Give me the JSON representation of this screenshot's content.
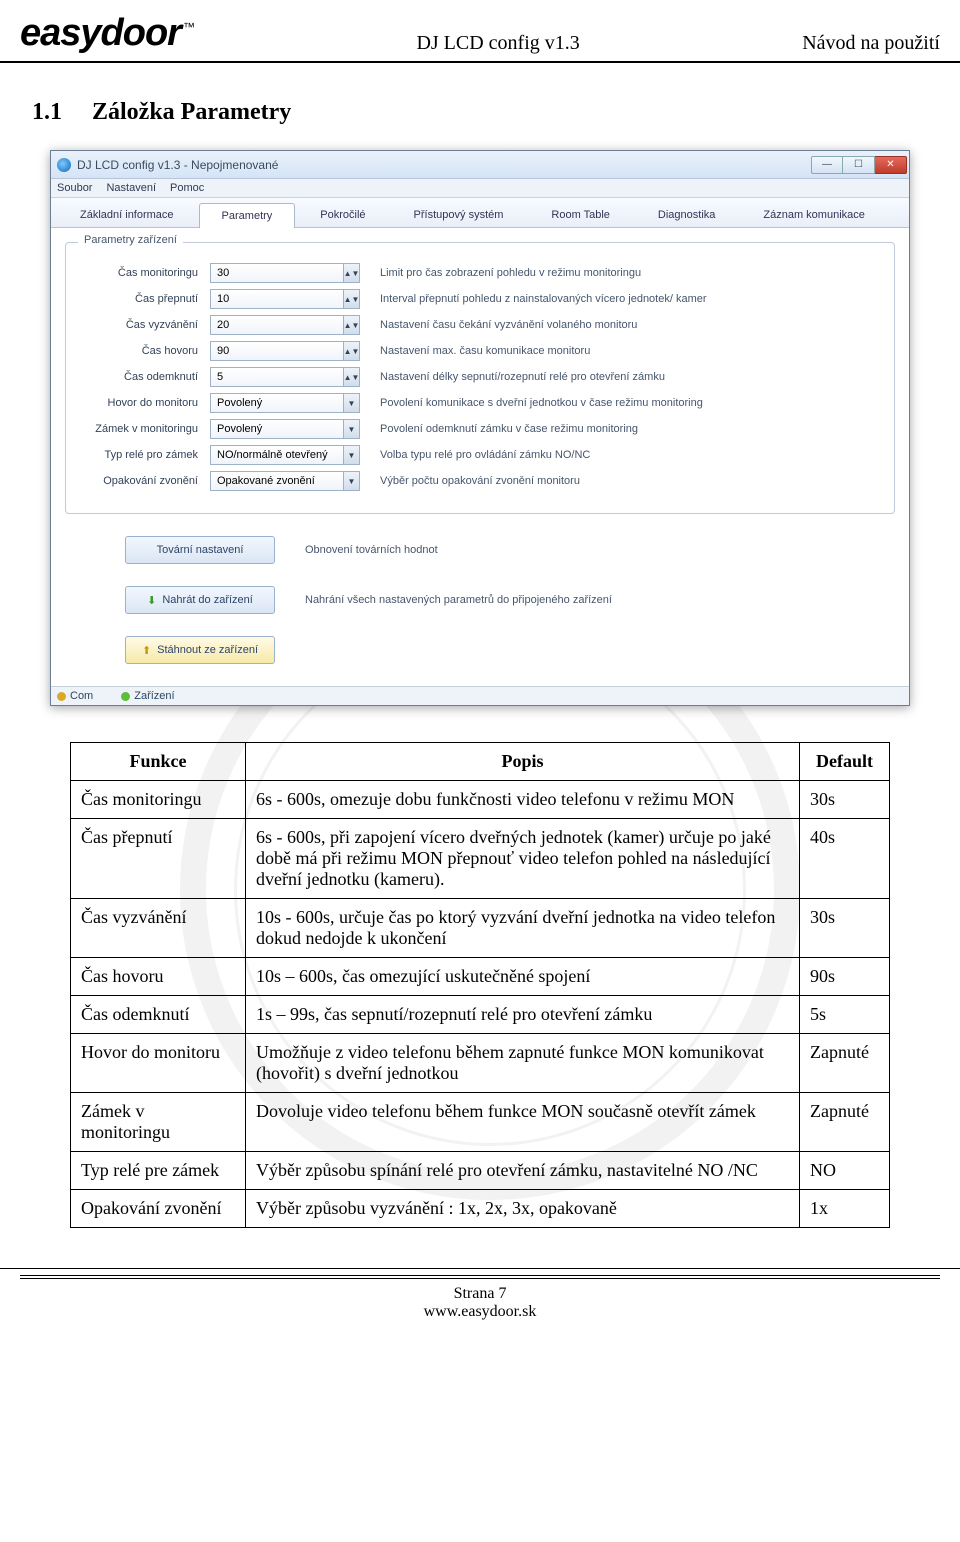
{
  "header": {
    "logo": "easydoor",
    "logo_tm": "™",
    "center": "DJ LCD config v1.3",
    "right": "Návod na použití"
  },
  "section": {
    "num": "1.1",
    "title": "Záložka Parametry"
  },
  "app": {
    "title": "DJ LCD config v1.3 - Nepojmenované",
    "menu": {
      "file": "Soubor",
      "settings": "Nastavení",
      "help": "Pomoc"
    },
    "tabs": {
      "basic": "Základní informace",
      "params": "Parametry",
      "advanced": "Pokročilé",
      "access": "Přístupový systém",
      "room": "Room Table",
      "diag": "Diagnostika",
      "comm": "Záznam komunikace"
    },
    "fieldset_legend": "Parametry zařízení",
    "rows": [
      {
        "label": "Čas monitoringu",
        "value": "30",
        "type": "spin",
        "desc": "Limit pro čas zobrazení pohledu v režimu monitoringu"
      },
      {
        "label": "Čas přepnutí",
        "value": "10",
        "type": "spin",
        "desc": "Interval přepnutí pohledu z nainstalovaných vícero jednotek/ kamer"
      },
      {
        "label": "Čas vyzvánění",
        "value": "20",
        "type": "spin",
        "desc": "Nastavení času čekání vyzvánění volaného monitoru"
      },
      {
        "label": "Čas hovoru",
        "value": "90",
        "type": "spin",
        "desc": "Nastavení max. času komunikace monitoru"
      },
      {
        "label": "Čas odemknutí",
        "value": "5",
        "type": "spin",
        "desc": "Nastavení délky sepnutí/rozepnutí relé pro otevření zámku"
      },
      {
        "label": "Hovor do monitoru",
        "value": "Povolený",
        "type": "dd",
        "desc": "Povolení komunikace s dveřní jednotkou v čase režimu monitoring"
      },
      {
        "label": "Zámek v monitoringu",
        "value": "Povolený",
        "type": "dd",
        "desc": "Povolení odemknutí zámku v čase režimu monitoring"
      },
      {
        "label": "Typ relé pro zámek",
        "value": "NO/normálně otevřený",
        "type": "dd",
        "desc": "Volba typu relé pro ovládání zámku NO/NC"
      },
      {
        "label": "Opakování zvonění",
        "value": "Opakované zvonění",
        "type": "dd",
        "desc": "Výběr počtu opakování zvonění monitoru"
      }
    ],
    "actions": {
      "factory": "Tovární nastavení",
      "factory_desc": "Obnovení továrních hodnot",
      "upload": "Nahrát do zařízení",
      "upload_desc": "Nahrání všech nastavených parametrů do připojeného zařízení",
      "download": "Stáhnout ze zařízení"
    },
    "status": {
      "com": "Com",
      "device": "Zařízení"
    },
    "win": {
      "min": "—",
      "max": "☐",
      "close": "✕"
    }
  },
  "table": {
    "headers": {
      "func": "Funkce",
      "desc": "Popis",
      "def": "Default"
    },
    "rows": [
      {
        "func": "Čas monitoringu",
        "desc": "6s - 600s, omezuje dobu funkčnosti video telefonu v režimu MON",
        "def": "30s"
      },
      {
        "func": "Čas přepnutí",
        "desc": "6s - 600s, při zapojení vícero dveřných jednotek (kamer) určuje po jaké době má při režimu MON přepnouť video telefon pohled na následující dveřní jednotku (kameru).",
        "def": "40s"
      },
      {
        "func": "Čas vyzvánění",
        "desc": "10s - 600s, určuje čas po ktorý vyzvání dveřní jednotka na video telefon dokud nedojde k ukončení",
        "def": "30s"
      },
      {
        "func": "Čas hovoru",
        "desc": "10s – 600s, čas omezující uskutečněné spojení",
        "def": "90s"
      },
      {
        "func": "Čas odemknutí",
        "desc": "1s – 99s, čas sepnutí/rozepnutí relé pro otevření zámku",
        "def": "5s"
      },
      {
        "func": "Hovor do monitoru",
        "desc": "Umožňuje z video telefonu během zapnuté funkce MON komunikovat (hovořit) s dveřní jednotkou",
        "def": "Zapnuté"
      },
      {
        "func": "Zámek v monitoringu",
        "desc": "Dovoluje video telefonu během funkce MON současně otevřít zámek",
        "def": "Zapnuté"
      },
      {
        "func": "Typ relé pre zámek",
        "desc": "Výběr způsobu spínání relé pro otevření zámku, nastavitelné NO /NC",
        "def": "NO"
      },
      {
        "func": "Opakování zvonění",
        "desc": "Výběr způsobu vyzvánění : 1x, 2x, 3x, opakovaně",
        "def": "1x"
      }
    ]
  },
  "footer": {
    "page": "Strana 7",
    "url": "www.easydoor.sk"
  }
}
